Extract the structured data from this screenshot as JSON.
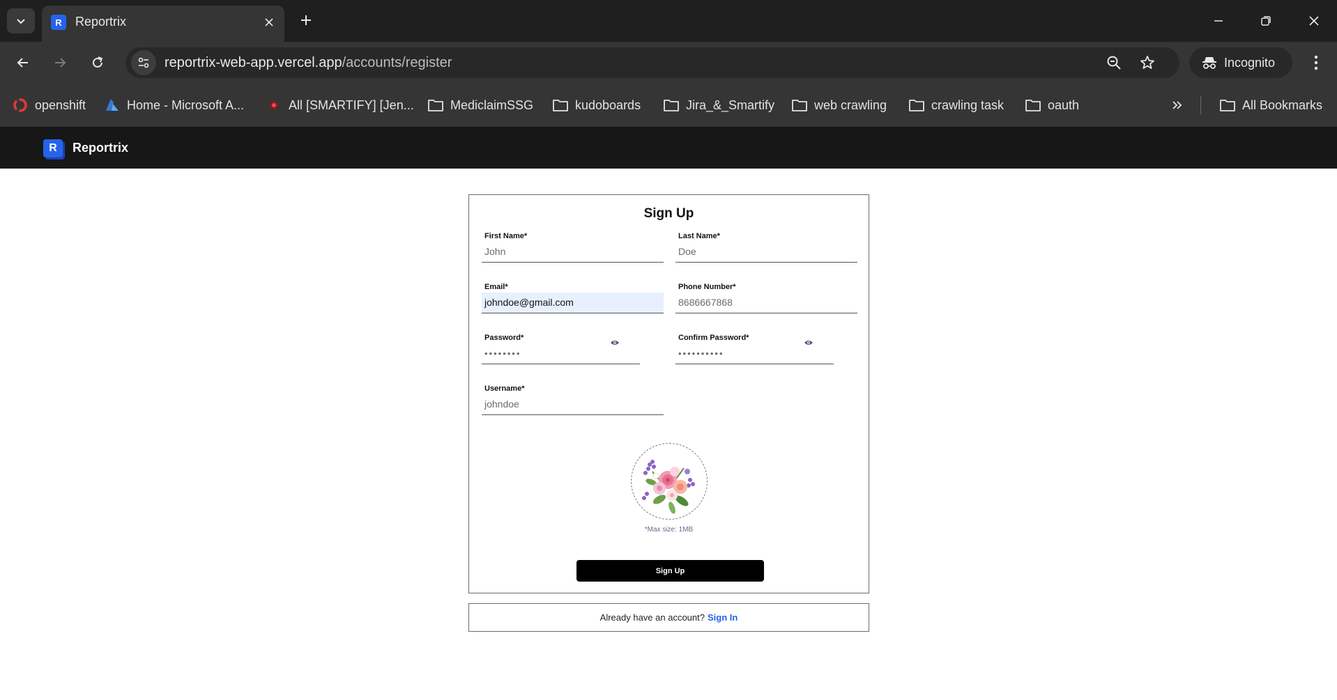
{
  "browser": {
    "tab_title": "Reportrix",
    "favicon_letter": "R",
    "url_host": "reportrix-web-app.vercel.app",
    "url_path": "/accounts/register",
    "incognito_label": "Incognito",
    "bookmarks": [
      {
        "label": "openshift",
        "icon": "openshift-icon"
      },
      {
        "label": "Home - Microsoft A...",
        "icon": "azure-icon"
      },
      {
        "label": "All [SMARTIFY] [Jen...",
        "icon": "jenkins-icon"
      },
      {
        "label": "MediclaimSSG",
        "icon": "folder-icon"
      },
      {
        "label": "kudoboards",
        "icon": "folder-icon"
      },
      {
        "label": "Jira_&_Smartify",
        "icon": "folder-icon"
      },
      {
        "label": "web crawling",
        "icon": "folder-icon"
      },
      {
        "label": "crawling task",
        "icon": "folder-icon"
      },
      {
        "label": "oauth",
        "icon": "folder-icon"
      }
    ],
    "all_bookmarks_label": "All Bookmarks"
  },
  "app": {
    "logo_letter": "R",
    "name": "Reportrix",
    "accent_color": "#2563eb"
  },
  "form": {
    "title": "Sign Up",
    "first_name": {
      "label": "First Name*",
      "placeholder": "John",
      "value": ""
    },
    "last_name": {
      "label": "Last Name*",
      "placeholder": "Doe",
      "value": ""
    },
    "email": {
      "label": "Email*",
      "value": "johndoe@gmail.com"
    },
    "phone": {
      "label": "Phone Number*",
      "placeholder": "8686667868",
      "value": ""
    },
    "password": {
      "label": "Password*",
      "masked": "••••••••"
    },
    "confirm_password": {
      "label": "Confirm Password*",
      "masked": "••••••••••"
    },
    "username": {
      "label": "Username*",
      "placeholder": "johndoe",
      "value": ""
    },
    "max_size_note": "*Max size: 1MB",
    "submit_label": "Sign Up"
  },
  "signin": {
    "prompt": "Already have an account?",
    "link": "Sign In"
  }
}
